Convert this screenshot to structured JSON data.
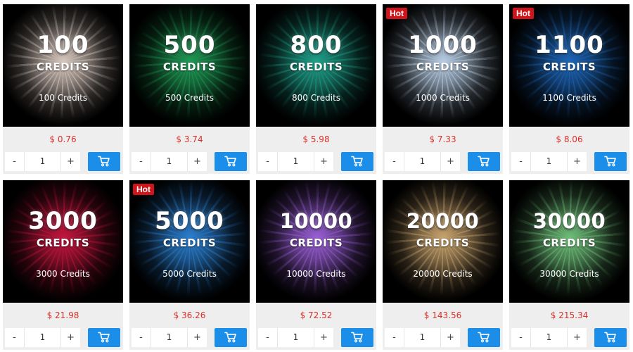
{
  "products": [
    {
      "amount": "100",
      "credits_word": "CREDITS",
      "caption": "100 Credits",
      "price": "$ 0.76",
      "quantity": "1",
      "hot": "",
      "accent": "#d9c9c0"
    },
    {
      "amount": "500",
      "credits_word": "CREDITS",
      "caption": "500 Credits",
      "price": "$ 3.74",
      "quantity": "1",
      "hot": "",
      "accent": "#1f9a55"
    },
    {
      "amount": "800",
      "credits_word": "CREDITS",
      "caption": "800 Credits",
      "price": "$ 5.98",
      "quantity": "1",
      "hot": "",
      "accent": "#1fa08a"
    },
    {
      "amount": "1000",
      "credits_word": "CREDITS",
      "caption": "1000 Credits",
      "price": "$ 7.33",
      "quantity": "1",
      "hot": "Hot",
      "accent": "#b9cfe6"
    },
    {
      "amount": "1100",
      "credits_word": "CREDITS",
      "caption": "1100 Credits",
      "price": "$ 8.06",
      "quantity": "1",
      "hot": "Hot",
      "accent": "#1e66b8"
    },
    {
      "amount": "3000",
      "credits_word": "CREDITS",
      "caption": "3000 Credits",
      "price": "$ 21.98",
      "quantity": "1",
      "hot": "",
      "accent": "#c4163e"
    },
    {
      "amount": "5000",
      "credits_word": "CREDITS",
      "caption": "5000 Credits",
      "price": "$ 36.26",
      "quantity": "1",
      "hot": "Hot",
      "accent": "#2b7fd0"
    },
    {
      "amount": "10000",
      "credits_word": "CREDITS",
      "caption": "10000 Credits",
      "price": "$ 72.52",
      "quantity": "1",
      "hot": "",
      "accent": "#9a5fd6"
    },
    {
      "amount": "20000",
      "credits_word": "CREDITS",
      "caption": "20000 Credits",
      "price": "$ 143.56",
      "quantity": "1",
      "hot": "",
      "accent": "#c9a46e"
    },
    {
      "amount": "30000",
      "credits_word": "CREDITS",
      "caption": "30000 Credits",
      "price": "$ 215.34",
      "quantity": "1",
      "hot": "",
      "accent": "#6fbf7a"
    }
  ],
  "controls": {
    "minus_label": "-",
    "plus_label": "+"
  },
  "icons": {
    "cart": "shopping-cart-icon"
  },
  "colors": {
    "price": "#d9302a",
    "cart_button": "#1a8ee8",
    "hot_badge": "#d3131a",
    "card_background": "#eeeeee"
  }
}
